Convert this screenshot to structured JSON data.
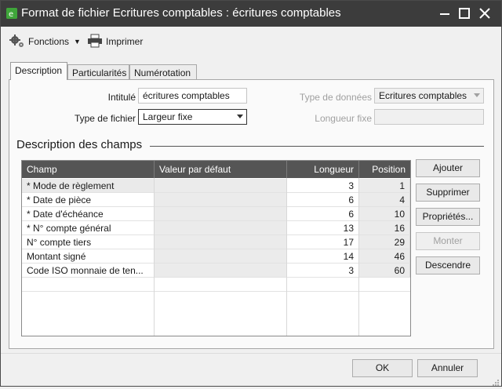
{
  "window": {
    "title": "Format de fichier Ecritures comptables : écritures comptables",
    "accent": "#3fa53a",
    "titlebar_color": "#3c3c3c"
  },
  "toolbar": {
    "functions_label": "Fonctions",
    "print_label": "Imprimer"
  },
  "tabs": [
    {
      "label": "Description",
      "active": true
    },
    {
      "label": "Particularités",
      "active": false
    },
    {
      "label": "Numérotation",
      "active": false
    }
  ],
  "form": {
    "intitule_label": "Intitulé",
    "intitule_value": "écritures comptables",
    "type_fichier_label": "Type de fichier",
    "type_fichier_value": "Largeur fixe",
    "type_donnees_label": "Type de données",
    "type_donnees_value": "Ecritures comptables",
    "longueur_fixe_label": "Longueur fixe",
    "longueur_fixe_value": ""
  },
  "fields_section": {
    "title": "Description des champs",
    "columns": [
      "Champ",
      "Valeur par défaut",
      "Longueur",
      "Position"
    ],
    "rows": [
      {
        "champ": "* Mode de règlement",
        "defaut": "",
        "longueur": "3",
        "position": "1"
      },
      {
        "champ": "* Date de pièce",
        "defaut": "",
        "longueur": "6",
        "position": "4"
      },
      {
        "champ": "* Date d'échéance",
        "defaut": "",
        "longueur": "6",
        "position": "10"
      },
      {
        "champ": "* N° compte général",
        "defaut": "",
        "longueur": "13",
        "position": "16"
      },
      {
        "champ": "N° compte tiers",
        "defaut": "",
        "longueur": "17",
        "position": "29"
      },
      {
        "champ": "Montant signé",
        "defaut": "",
        "longueur": "14",
        "position": "46"
      },
      {
        "champ": "Code ISO monnaie de ten...",
        "defaut": "",
        "longueur": "3",
        "position": "60"
      }
    ]
  },
  "side_buttons": {
    "ajouter": "Ajouter",
    "supprimer": "Supprimer",
    "proprietes": "Propriétés...",
    "monter": "Monter",
    "descendre": "Descendre"
  },
  "footer": {
    "ok": "OK",
    "annuler": "Annuler"
  }
}
